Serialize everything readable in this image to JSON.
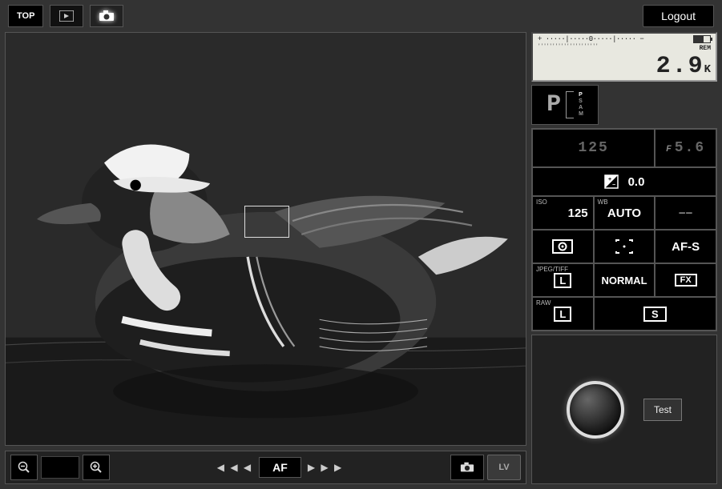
{
  "topbar": {
    "top_label": "TOP",
    "logout_label": "Logout"
  },
  "lcd": {
    "ev_scale": "+ ·····|·····0·····|····· −",
    "ticks": "'''''''''''''''''''''",
    "rem_label": "REM",
    "count_value": "2.9",
    "count_unit": "K"
  },
  "mode": {
    "current": "P",
    "list": [
      "P",
      "S",
      "A",
      "M"
    ]
  },
  "settings": {
    "shutter_speed": "125",
    "aperture": "5.6",
    "aperture_prefix": "F",
    "ev_comp": "0.0",
    "iso_label": "ISO",
    "iso_value": "125",
    "wb_label": "WB",
    "wb_value": "AUTO",
    "flash_comp": "−−",
    "af_mode": "AF-S",
    "img_fmt_label": "JPEG/TIFF",
    "img_size": "L",
    "quality": "NORMAL",
    "crop": "FX",
    "raw_label": "RAW",
    "raw_size": "L",
    "release_mode": "S"
  },
  "toolbar": {
    "af_label": "AF",
    "lv_label": "LV",
    "arrows_left": "◀ ◀ ◀",
    "arrows_right": "▶ ▶ ▶"
  },
  "shutter_zone": {
    "test_label": "Test"
  }
}
